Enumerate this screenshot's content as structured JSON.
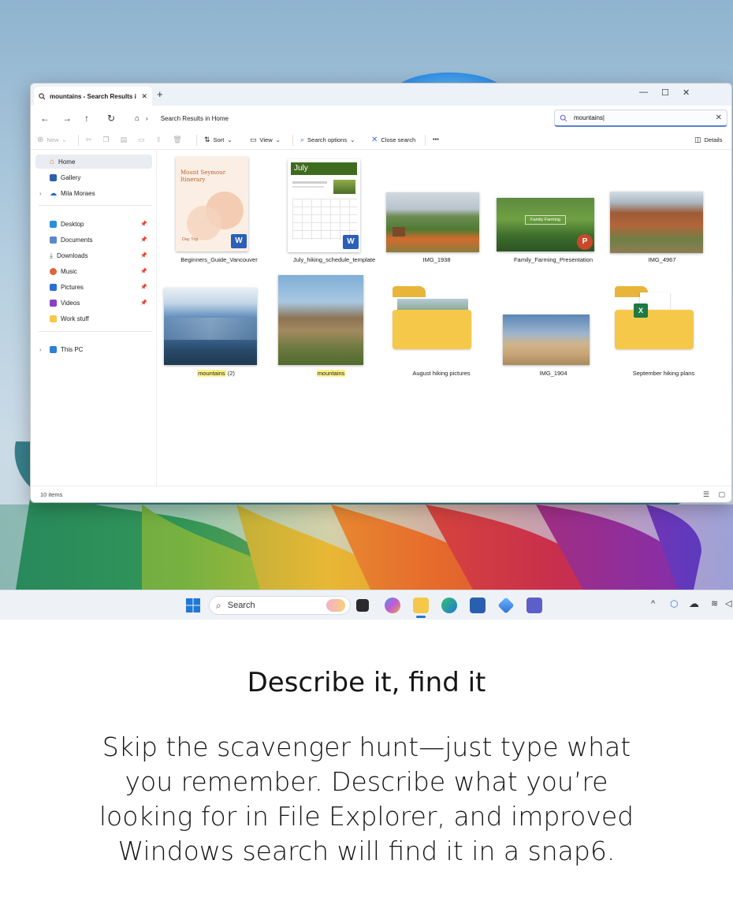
{
  "window": {
    "tab_title": "mountains - Search Results i",
    "breadcrumb": "Search Results in Home",
    "search_value": "mountains|",
    "command_bar": {
      "new": "New",
      "sort": "Sort",
      "view": "View",
      "search_options": "Search options",
      "close_search": "Close search",
      "more": "•••",
      "details": "Details"
    },
    "nav": {
      "home": "Home",
      "gallery": "Gallery",
      "user": "Mila Moraes",
      "desktop": "Desktop",
      "documents": "Documents",
      "downloads": "Downloads",
      "music": "Music",
      "pictures": "Pictures",
      "videos": "Videos",
      "work_stuff": "Work stuff",
      "this_pc": "This PC"
    },
    "files": [
      {
        "name": "Beginners_Guide_Vancouver",
        "doc_title": "Mount Seymour Itinerary",
        "doc_sub": "Day Trip",
        "app_badge": "W"
      },
      {
        "name": "July_hiking_schedule_template",
        "doc_title": "July",
        "app_badge": "W"
      },
      {
        "name": "IMG_1938"
      },
      {
        "name": "Family_Farming_Presentation",
        "doc_title": "Family Farming",
        "app_badge": "P"
      },
      {
        "name": "IMG_4967"
      },
      {
        "name_hl": "mountains",
        "name_rest": " (2)"
      },
      {
        "name_hl": "mountains",
        "name_rest": ""
      },
      {
        "name": "August hiking pictures"
      },
      {
        "name": "IMG_1904"
      },
      {
        "name": "September hiking plans",
        "app_badge": "X"
      }
    ],
    "status": "10 items"
  },
  "taskbar": {
    "search_label": "Search"
  },
  "copy": {
    "heading": "Describe it, find it",
    "body": "Skip the scavenger hunt—just type what you remember. Describe what you’re looking for in File Explorer, and improved Windows search will find it in a snap6."
  },
  "colors": {
    "accent": "#3b6fd8",
    "highlight": "#fff28a",
    "folder": "#f6c84a",
    "word": "#2b5fb8",
    "powerpoint": "#c9482a",
    "excel": "#1f7a45"
  }
}
